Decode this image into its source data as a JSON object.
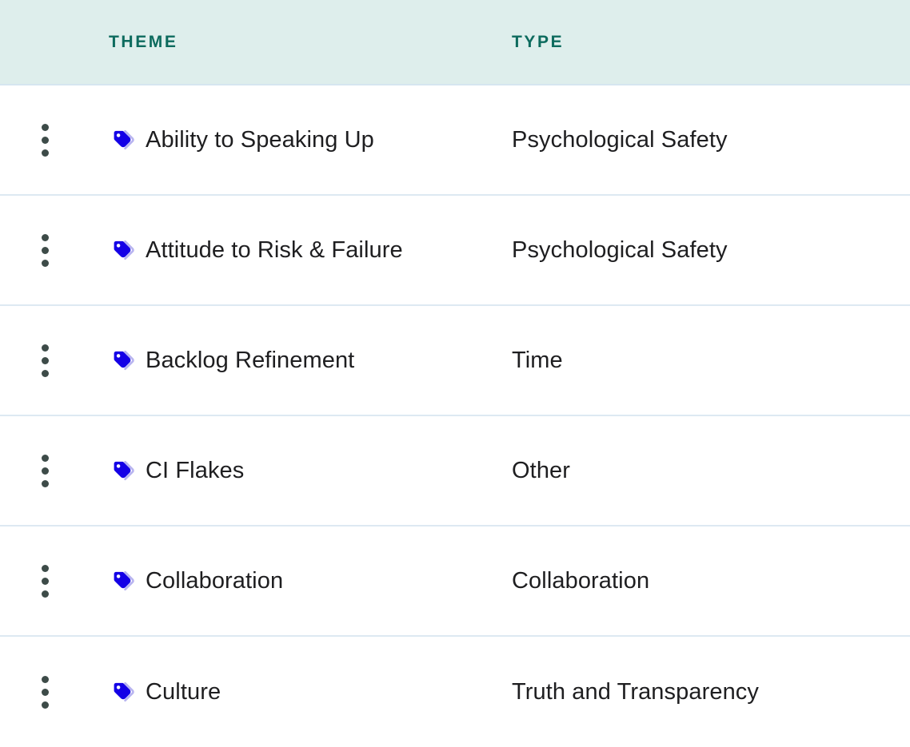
{
  "table": {
    "columns": [
      {
        "key": "menu",
        "label": ""
      },
      {
        "key": "theme",
        "label": "THEME"
      },
      {
        "key": "type",
        "label": "TYPE"
      }
    ],
    "header": {
      "theme_label": "THEME",
      "type_label": "TYPE"
    },
    "row_menu_icon": "kebab-menu-icon",
    "row_tag_icon": "tag-icon",
    "rows": [
      {
        "theme": "Ability to Speaking Up",
        "type": "Psychological Safety"
      },
      {
        "theme": "Attitude to Risk & Failure",
        "type": "Psychological Safety"
      },
      {
        "theme": "Backlog Refinement",
        "type": "Time"
      },
      {
        "theme": "CI Flakes",
        "type": "Other"
      },
      {
        "theme": "Collaboration",
        "type": "Collaboration"
      },
      {
        "theme": "Culture",
        "type": "Truth and Transparency"
      }
    ]
  },
  "colors": {
    "header_background": "#deeeec",
    "header_text": "#0d6b5e",
    "row_divider": "#dde9f2",
    "body_text": "#1e1e20",
    "tag_icon_primary": "#1400e6",
    "tag_icon_secondary": "#b7b3f0",
    "kebab_dot": "#3d4b48",
    "row_background": "#ffffff"
  }
}
